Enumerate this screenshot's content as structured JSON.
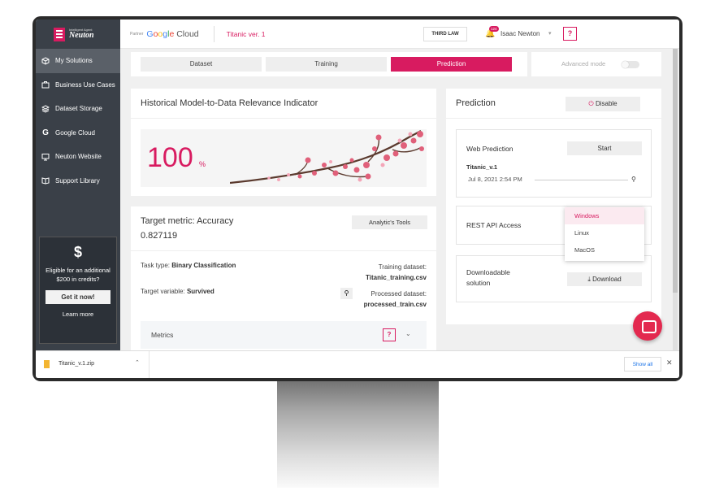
{
  "app": {
    "logo_small": "Intelligent Agent",
    "logo_name": "Neuton"
  },
  "sidebar": {
    "items": [
      {
        "label": "My Solutions",
        "icon": "cube-icon"
      },
      {
        "label": "Business Use Cases",
        "icon": "briefcase-icon"
      },
      {
        "label": "Dataset Storage",
        "icon": "layers-icon"
      },
      {
        "label": "Google Cloud",
        "icon": "google-g-icon"
      },
      {
        "label": "Neuton Website",
        "icon": "monitor-icon"
      },
      {
        "label": "Support Library",
        "icon": "book-icon"
      }
    ],
    "active_index": 0,
    "promo": {
      "symbol": "$",
      "text": "Eligible for an additional $200 in credits?",
      "button": "Get it now!",
      "link": "Learn more"
    }
  },
  "topbar": {
    "partner": "Partner",
    "google_cloud": {
      "g": "G",
      "o1": "o",
      "o2": "o",
      "g2": "g",
      "l": "l",
      "e": "e",
      "cloud": " Cloud"
    },
    "project": "Titanic ver. 1",
    "third_law": "THIRD LAW",
    "notifications": "124",
    "user": "Isaac Newton",
    "help": "?"
  },
  "tabs": [
    {
      "label": "Dataset"
    },
    {
      "label": "Training"
    },
    {
      "label": "Prediction"
    }
  ],
  "active_tab": 2,
  "advanced_mode": {
    "label": "Advanced mode",
    "on": false
  },
  "historical": {
    "title": "Historical Model-to-Data Relevance Indicator",
    "value": "100",
    "unit": "%"
  },
  "target": {
    "title": "Target metric:  Accuracy",
    "value": "0.827119",
    "analytic_button": "Analytic's Tools",
    "task_type_label": "Task type:",
    "task_type_value": "Binary Classification",
    "target_var_label": "Target variable:",
    "target_var_value": "Survived",
    "training_label": "Training dataset:",
    "training_value": "Titanic_training.csv",
    "processed_label": "Processed dataset:",
    "processed_value": "processed_train.csv",
    "metrics_label": "Metrics",
    "metrics_help": "?"
  },
  "prediction": {
    "title": "Prediction",
    "disable_button": "Disable",
    "web": {
      "title": "Web Prediction",
      "start_button": "Start",
      "model_name": "Titanic_v.1",
      "model_date": "Jul 8, 2021 2:54 PM"
    },
    "rest": {
      "title": "REST API Access"
    },
    "downloadable": {
      "title": "Downloadable solution",
      "button": "Download"
    },
    "os_options": [
      "Windows",
      "Linux",
      "MacOS"
    ],
    "os_selected": "Windows"
  },
  "download_bar": {
    "file": "Titanic_v.1.zip",
    "show_all": "Show all"
  },
  "colors": {
    "accent": "#d81b60",
    "sidebar": "#3a4048"
  }
}
